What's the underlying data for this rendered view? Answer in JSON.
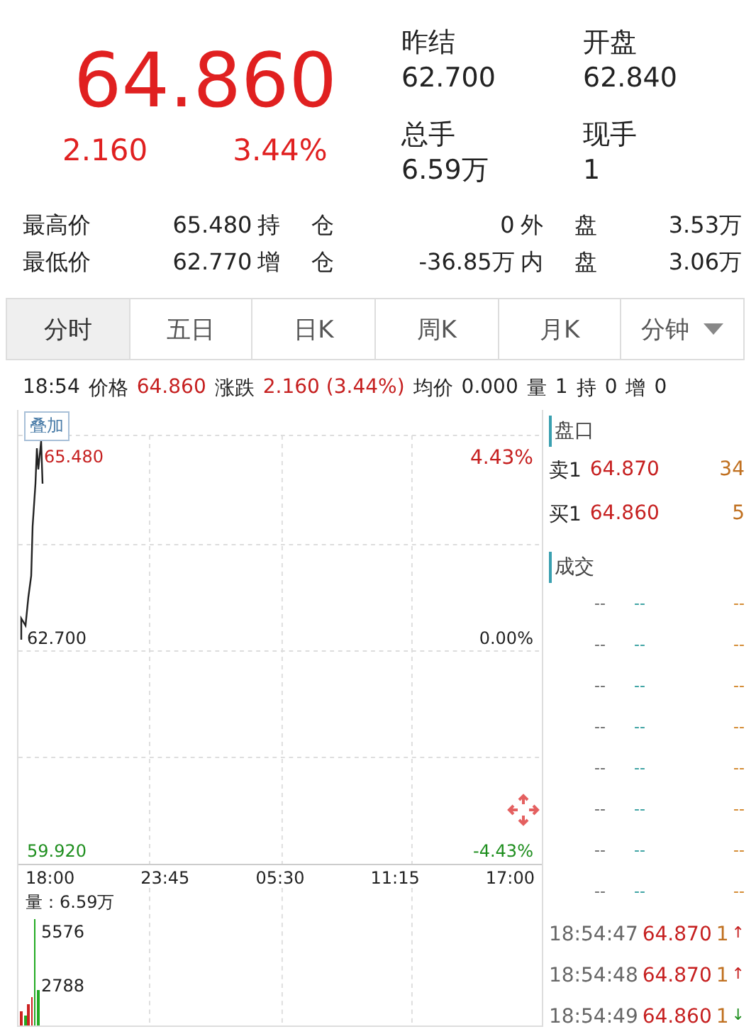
{
  "quote": {
    "price": "64.860",
    "change": "2.160",
    "change_pct": "3.44%"
  },
  "summary": [
    {
      "label": "昨结",
      "value": "62.700"
    },
    {
      "label": "开盘",
      "value": "62.840"
    },
    {
      "label": "总手",
      "value": "6.59万"
    },
    {
      "label": "现手",
      "value": "1"
    }
  ],
  "stats": [
    {
      "label": "最高价",
      "value": "65.480",
      "label2": "持仓",
      "value2": "0",
      "label3": "外盘",
      "value3": "3.53万"
    },
    {
      "label": "最低价",
      "value": "62.770",
      "label2": "增仓",
      "value2": "-36.85万",
      "label3": "内盘",
      "value3": "3.06万"
    }
  ],
  "tabs": [
    {
      "label": "分时",
      "selected": true,
      "dropdown": false
    },
    {
      "label": "五日",
      "selected": false,
      "dropdown": false
    },
    {
      "label": "日K",
      "selected": false,
      "dropdown": false
    },
    {
      "label": "周K",
      "selected": false,
      "dropdown": false
    },
    {
      "label": "月K",
      "selected": false,
      "dropdown": false
    },
    {
      "label": "分钟",
      "selected": false,
      "dropdown": true
    }
  ],
  "info_line": [
    {
      "label": "18:54",
      "kind": "plain"
    },
    {
      "label": "价格",
      "kind": "plain"
    },
    {
      "label": "64.860",
      "kind": "red"
    },
    {
      "label": "涨跌",
      "kind": "plain"
    },
    {
      "label": "2.160 (3.44%)",
      "kind": "red"
    },
    {
      "label": "均价",
      "kind": "plain"
    },
    {
      "label": "0.000",
      "kind": "plain"
    },
    {
      "label": "量",
      "kind": "plain"
    },
    {
      "label": "1",
      "kind": "plain"
    },
    {
      "label": "持",
      "kind": "plain"
    },
    {
      "label": "0",
      "kind": "plain"
    },
    {
      "label": "增",
      "kind": "plain"
    },
    {
      "label": "0",
      "kind": "plain"
    }
  ],
  "chart": {
    "overlay_button": "叠加",
    "price_high": "65.480",
    "pct_high": "4.43%",
    "price_mid": "62.700",
    "pct_mid": "0.00%",
    "price_low": "59.920",
    "pct_low": "-4.43%",
    "times": [
      "18:00",
      "23:45",
      "05:30",
      "11:15",
      "17:00"
    ],
    "volume_label": "量：6.59万",
    "volume_high": "5576",
    "volume_mid": "2788"
  },
  "order_book": {
    "title": "盘口",
    "rows": [
      {
        "label": "卖1",
        "price": "64.870",
        "volume": "34"
      },
      {
        "label": "买1",
        "price": "64.860",
        "volume": "5"
      }
    ]
  },
  "trades": {
    "title": "成交",
    "empty_rows": [
      [
        "--",
        "--",
        "--"
      ],
      [
        "--",
        "--",
        "--"
      ],
      [
        "--",
        "--",
        "--"
      ],
      [
        "--",
        "--",
        "--"
      ],
      [
        "--",
        "--",
        "--"
      ],
      [
        "--",
        "--",
        "--"
      ],
      [
        "--",
        "--",
        "--"
      ],
      [
        "--",
        "--",
        "--"
      ]
    ],
    "rows": [
      {
        "time": "18:54:47",
        "price": "64.870",
        "volume": "1",
        "arrow": "↑",
        "kind": "up"
      },
      {
        "time": "18:54:48",
        "price": "64.870",
        "volume": "1",
        "arrow": "↑",
        "kind": "up"
      },
      {
        "time": "18:54:49",
        "price": "64.860",
        "volume": "1",
        "arrow": "↓",
        "kind": "down"
      }
    ]
  }
}
